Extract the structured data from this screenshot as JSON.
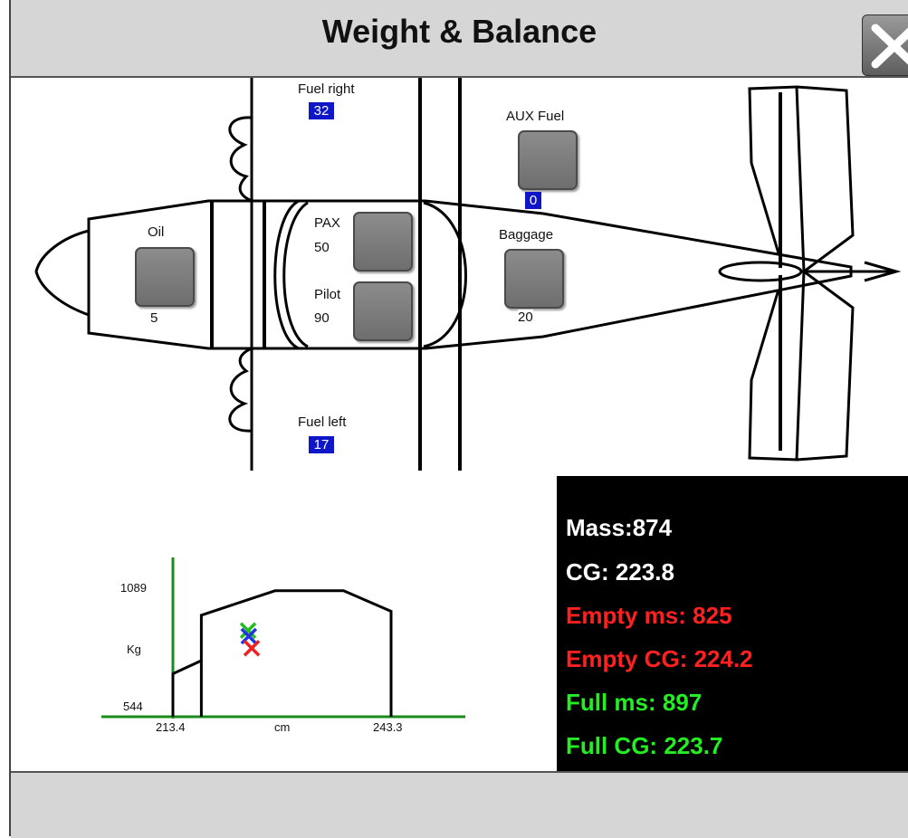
{
  "window": {
    "title": "Weight & Balance"
  },
  "aircraft": {
    "fuel_right": {
      "label": "Fuel right",
      "value": "32"
    },
    "fuel_left": {
      "label": "Fuel left",
      "value": "17"
    },
    "aux_fuel": {
      "label": "AUX Fuel",
      "value": "0"
    },
    "oil": {
      "label": "Oil",
      "value": "5"
    },
    "pax": {
      "label": "PAX",
      "value": "50"
    },
    "pilot": {
      "label": "Pilot",
      "value": "90"
    },
    "baggage": {
      "label": "Baggage",
      "value": "20"
    }
  },
  "stats": {
    "mass": "Mass:874",
    "cg": "CG: 223.8",
    "empty_ms": "Empty ms: 825",
    "empty_cg": "Empty CG: 224.2",
    "full_ms": "Full ms: 897",
    "full_cg": "Full CG: 223.7",
    "colors": {
      "current": "#ffffff",
      "empty": "#ff2020",
      "full": "#22ee22"
    }
  },
  "chart_data": {
    "type": "scatter",
    "xlabel": "cm",
    "ylabel": "Kg",
    "x_ticks": [
      "213.4",
      "243.3"
    ],
    "y_ticks": [
      "1089",
      "544"
    ],
    "xlim": [
      213.4,
      243.3
    ],
    "ylim": [
      544,
      1089
    ],
    "envelope": [
      {
        "x": 213.4,
        "y": 544
      },
      {
        "x": 213.4,
        "y": 720
      },
      {
        "x": 217.3,
        "y": 774
      },
      {
        "x": 217.3,
        "y": 544
      },
      {
        "x": 217.3,
        "y": 774
      },
      {
        "x": 217.3,
        "y": 960
      },
      {
        "x": 227.4,
        "y": 1060
      },
      {
        "x": 236.8,
        "y": 1060
      },
      {
        "x": 243.3,
        "y": 976
      },
      {
        "x": 243.3,
        "y": 544
      }
    ],
    "series": [
      {
        "name": "Full",
        "color": "#22bb22",
        "x": 223.7,
        "y": 897
      },
      {
        "name": "Current",
        "color": "#2233dd",
        "x": 223.8,
        "y": 874
      },
      {
        "name": "Empty",
        "color": "#ee2020",
        "x": 224.2,
        "y": 825
      }
    ]
  }
}
